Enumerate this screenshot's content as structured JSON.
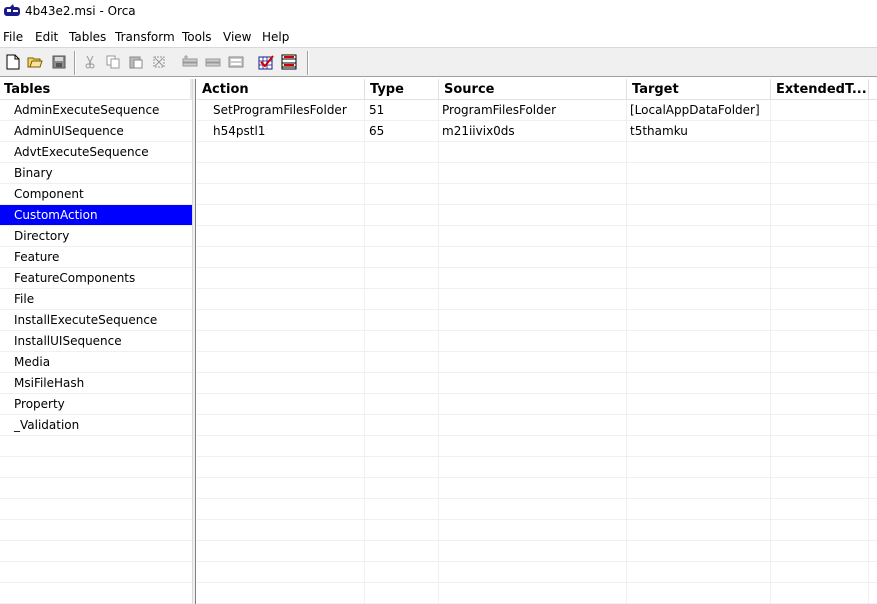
{
  "window": {
    "title": "4b43e2.msi - Orca"
  },
  "menu": [
    "File",
    "Edit",
    "Tables",
    "Transform",
    "Tools",
    "View",
    "Help"
  ],
  "left": {
    "header": "Tables",
    "items": [
      "AdminExecuteSequence",
      "AdminUISequence",
      "AdvtExecuteSequence",
      "Binary",
      "Component",
      "CustomAction",
      "Directory",
      "Feature",
      "FeatureComponents",
      "File",
      "InstallExecuteSequence",
      "InstallUISequence",
      "Media",
      "MsiFileHash",
      "Property",
      "_Validation"
    ],
    "selected": "CustomAction"
  },
  "grid": {
    "columns": [
      "Action",
      "Type",
      "Source",
      "Target",
      "ExtendedT..."
    ],
    "rows": [
      [
        "SetProgramFilesFolder",
        "51",
        "ProgramFilesFolder",
        "[LocalAppDataFolder]",
        ""
      ],
      [
        "h54pstl1",
        "65",
        "m21iivix0ds",
        "t5thamku",
        ""
      ]
    ]
  },
  "colors": {
    "selection": "#0000ff",
    "toolbar_bg": "#f0f0f0"
  },
  "toolbar_icons": [
    "new-file-icon",
    "open-folder-icon",
    "save-icon",
    "cut-icon",
    "copy-icon",
    "paste-icon",
    "delete-icon",
    "add-row-icon",
    "drop-row-icon",
    "table-props-icon",
    "validate-icon",
    "transform-icon"
  ]
}
